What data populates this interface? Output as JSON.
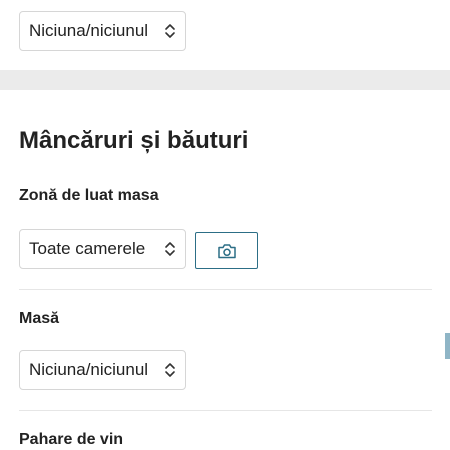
{
  "top_select": {
    "value": "Niciuna/niciunul"
  },
  "section": {
    "title": "Mâncăruri și băuturi"
  },
  "dining_area": {
    "label": "Zonă de luat masa",
    "select_value": "Toate camerele",
    "camera_icon": "camera-icon"
  },
  "table": {
    "label": "Masă",
    "select_value": "Niciuna/niciunul"
  },
  "wine_glasses": {
    "label": "Pahare de vin"
  },
  "colors": {
    "accent": "#2c6e86",
    "band": "#ebebeb",
    "border": "#d6d6d6",
    "text": "#222222"
  }
}
